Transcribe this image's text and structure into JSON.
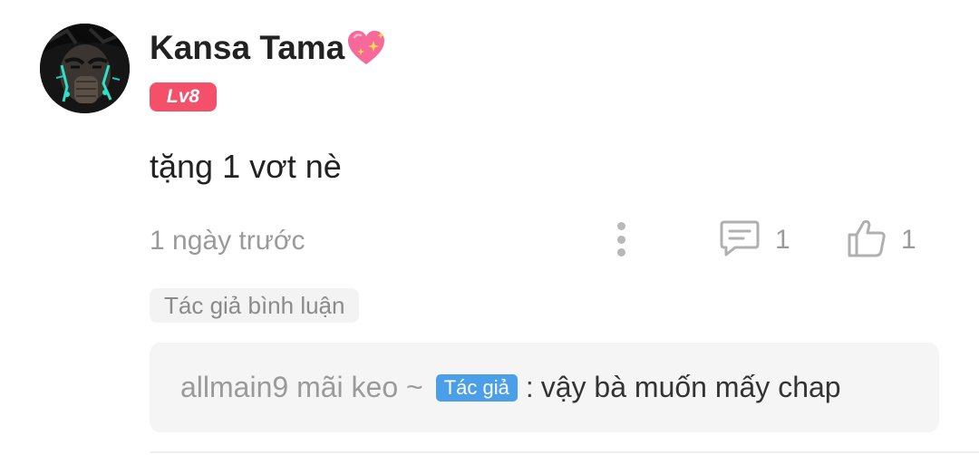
{
  "comment": {
    "user": {
      "name": "Kansa Tama",
      "name_icon": "sparkling-heart-icon",
      "level": "Lv8",
      "avatar_icon": "avatar-image"
    },
    "text": "tặng 1 vơt nè",
    "timestamp": "1 ngày trước",
    "actions": {
      "more_icon": "more-vertical-icon",
      "reply_icon": "comment-icon",
      "reply_count": "1",
      "like_icon": "thumbs-up-icon",
      "like_count": "1"
    },
    "author_tag": "Tác giả bình luận",
    "reply": {
      "author": "allmain9 mãi keo ~",
      "badge": "Tác giả",
      "separator": ":",
      "text": "vậy bà muốn mấy chap"
    }
  },
  "colors": {
    "level_badge": "#f4506a",
    "author_badge": "#4a9fe8",
    "muted_text": "#9a9a9a",
    "primary_text": "#222222",
    "reply_bg": "#f5f5f5"
  }
}
